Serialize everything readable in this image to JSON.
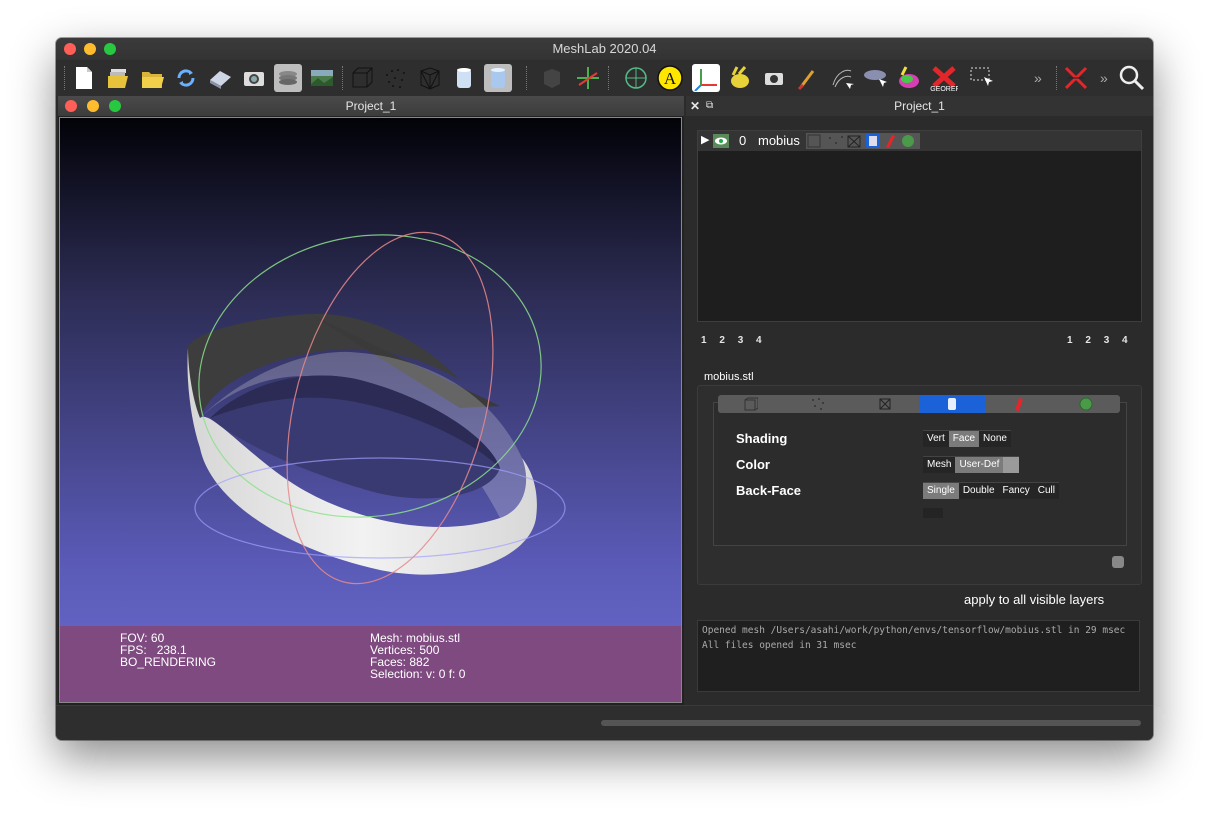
{
  "app": {
    "title": "MeshLab 2020.04"
  },
  "toolbar": {
    "buttons": [
      "new-project",
      "open-project",
      "import-mesh",
      "reload",
      "save-mesh",
      "snapshot",
      "layers",
      "raster",
      "bbox",
      "points",
      "wireframe",
      "flat",
      "smooth"
    ],
    "overflow": "»"
  },
  "subwindow": {
    "title": "Project_1"
  },
  "viewport": {
    "fov_label": "FOV: 60",
    "fps_label": "FPS:",
    "fps_value": "238.1",
    "render_mode": "BO_RENDERING",
    "mesh_label": "Mesh: mobius.stl",
    "vertices_label": "Vertices: 500",
    "faces_label": "Faces: 882",
    "selection_label": "Selection: v: 0 f: 0"
  },
  "panel": {
    "title": "Project_1",
    "layer": {
      "index": "0",
      "name": "mobius"
    },
    "left_nums": [
      "1",
      "2",
      "3",
      "4"
    ],
    "right_nums": [
      "1",
      "2",
      "3",
      "4"
    ],
    "mesh_file": "mobius.stl",
    "shading_label": "Shading",
    "shading_options": [
      "Vert",
      "Face",
      "None"
    ],
    "color_label": "Color",
    "color_options": [
      "Mesh",
      "User-Def"
    ],
    "backface_label": "Back-Face",
    "backface_options": [
      "Single",
      "Double",
      "Fancy",
      "Cull"
    ],
    "apply_label": "apply to all visible layers",
    "log_lines": [
      "Opened mesh /Users/asahi/work/python/envs/tensorflow/mobius.stl in 29 msec",
      "All files opened in 31 msec"
    ]
  },
  "colors": {
    "viewport_top": "#020208",
    "viewport_bottom": "#6b6bd0",
    "hud": "#7e4a80",
    "selected_tab": "#1b62d8"
  }
}
